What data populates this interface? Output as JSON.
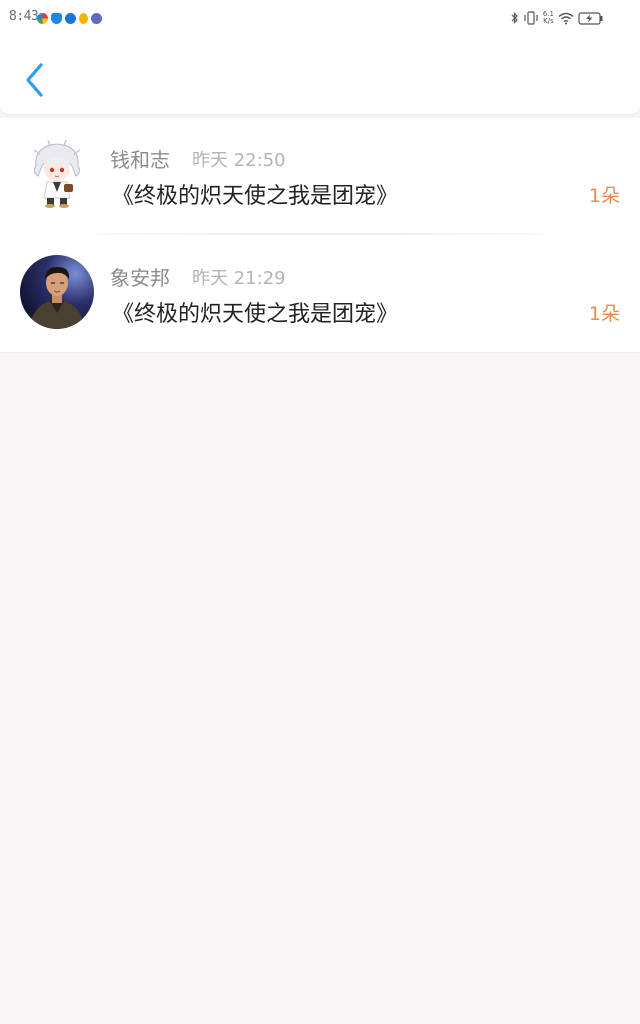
{
  "status_bar": {
    "time": "8:43",
    "network_speed_value": "6.1",
    "network_speed_unit": "K/s",
    "app_icons": [
      {
        "name": "multicolor-app-icon",
        "color": "#2fa84f"
      },
      {
        "name": "shield-app-icon",
        "color": "#1e88e5"
      },
      {
        "name": "blue-app-icon",
        "color": "#1976d2"
      },
      {
        "name": "bulb-app-icon",
        "color": "#f5b400"
      },
      {
        "name": "purple-app-icon",
        "color": "#5c6bc0"
      }
    ],
    "system_icons": [
      "bluetooth-icon",
      "vibrate-icon",
      "wifi-icon",
      "battery-charging-icon"
    ]
  },
  "header": {
    "back_icon": "chevron-left-icon",
    "accent_color": "#2b9ff0"
  },
  "records": [
    {
      "username": "钱和志",
      "time": "昨天 22:50",
      "title": "《终极的炽天使之我是团宠》",
      "gift": "1朵",
      "avatar": "anime-character-avatar"
    },
    {
      "username": "象安邦",
      "time": "昨天 21:29",
      "title": "《终极的炽天使之我是团宠》",
      "gift": "1朵",
      "avatar": "portrait-photo-avatar"
    }
  ],
  "colors": {
    "gift_text": "#ee8a48",
    "username_text": "#8c8c8c",
    "time_text": "#b4b4b4",
    "title_text": "#222222",
    "page_background": "#f7f5f6"
  }
}
